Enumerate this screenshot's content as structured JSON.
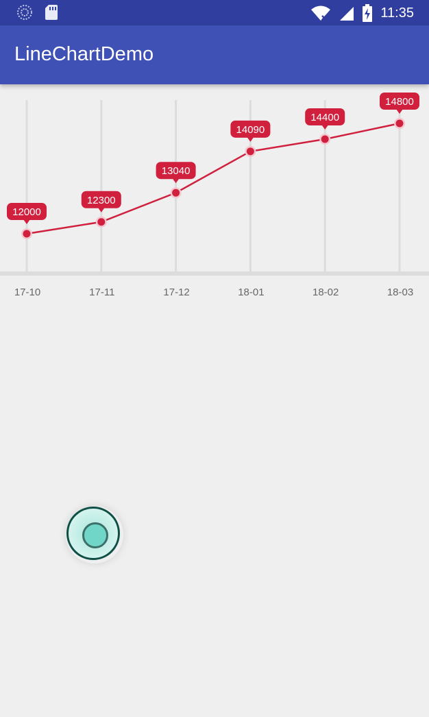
{
  "status_bar": {
    "time": "11:35",
    "icons": [
      "loading-spinner-icon",
      "sd-card-icon",
      "wifi-icon",
      "cell-signal-icon",
      "battery-charging-icon"
    ]
  },
  "app_bar": {
    "title": "LineChartDemo"
  },
  "colors": {
    "status_bar": "#303f9f",
    "app_bar": "#3f51b5",
    "line": "#d0203e",
    "label_bg": "#d0203e",
    "grid": "#dcdcdc",
    "fab_ring": "#0f4f45",
    "fab_fill": "#6fd6c8"
  },
  "chart_data": {
    "type": "line",
    "categories": [
      "17-10",
      "17-11",
      "17-12",
      "18-01",
      "18-02",
      "18-03"
    ],
    "values": [
      12000,
      12300,
      13040,
      14090,
      14400,
      14800
    ],
    "title": "",
    "xlabel": "",
    "ylabel": "",
    "data_labels": true,
    "grid": "vertical"
  },
  "fab": {
    "icon": "circle-button-icon"
  }
}
